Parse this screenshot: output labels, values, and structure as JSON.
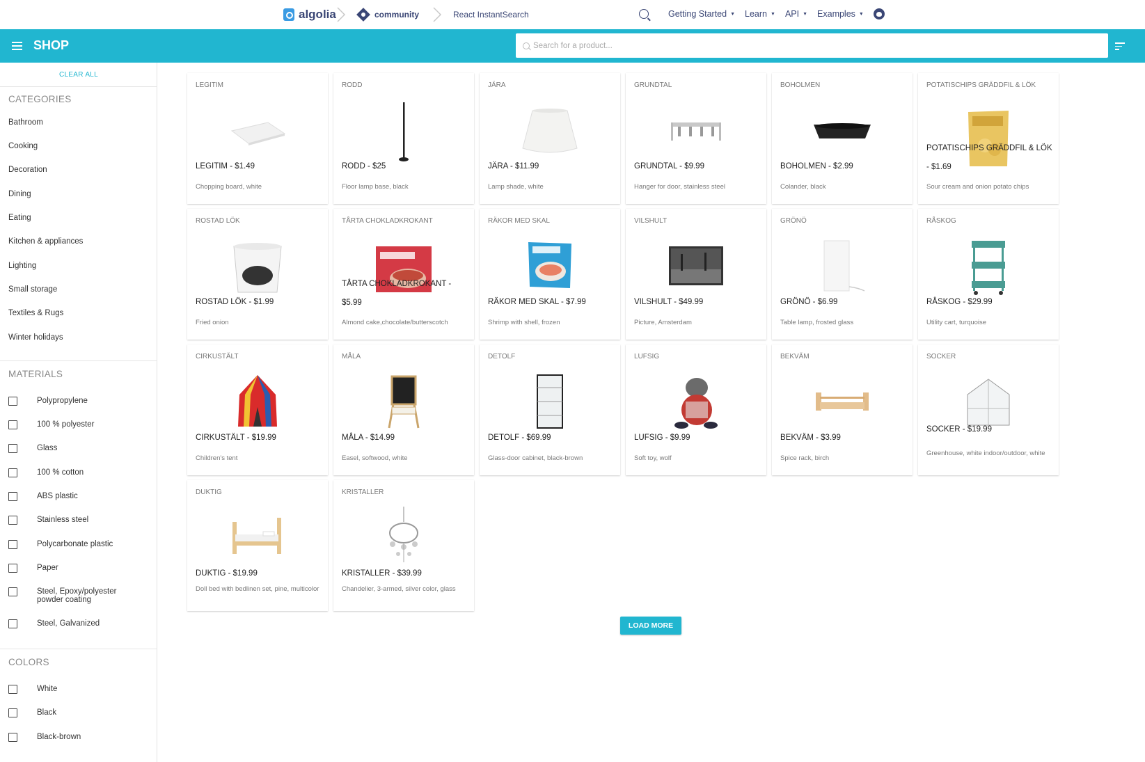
{
  "topbar": {
    "brand": "algolia",
    "community": "community",
    "section": "React InstantSearch",
    "nav": [
      {
        "label": "Getting Started",
        "dropdown": true
      },
      {
        "label": "Learn",
        "dropdown": true
      },
      {
        "label": "API",
        "dropdown": true
      },
      {
        "label": "Examples",
        "dropdown": true
      }
    ],
    "icons": [
      "search-icon",
      "github-icon"
    ]
  },
  "shop": {
    "title": "SHOP",
    "search_placeholder": "Search for a product...",
    "accent_color": "#21b6d0"
  },
  "sidebar": {
    "clear_all": "CLEAR ALL",
    "categories_title": "CATEGORIES",
    "categories": [
      "Bathroom",
      "Cooking",
      "Decoration",
      "Dining",
      "Eating",
      "Kitchen & appliances",
      "Lighting",
      "Small storage",
      "Textiles & Rugs",
      "Winter holidays"
    ],
    "materials_title": "MATERIALS",
    "materials": [
      "Polypropylene",
      "100 % polyester",
      "Glass",
      "100 % cotton",
      "ABS plastic",
      "Stainless steel",
      "Polycarbonate plastic",
      "Paper",
      "Steel, Epoxy/polyester powder coating",
      "Steel, Galvanized"
    ],
    "colors_title": "COLORS",
    "colors": [
      "White",
      "Black",
      "Black-brown"
    ]
  },
  "products": [
    {
      "category": "LEGITIM",
      "title": "LEGITIM - $1.49",
      "desc": "Chopping board, white",
      "img": "cutting-board"
    },
    {
      "category": "RODD",
      "title": "RODD - $25",
      "desc": "Floor lamp base, black",
      "img": "floor-lamp"
    },
    {
      "category": "JÄRA",
      "title": "JÄRA - $11.99",
      "desc": "Lamp shade, white",
      "img": "lamp-shade"
    },
    {
      "category": "GRUNDTAL",
      "title": "GRUNDTAL - $9.99",
      "desc": "Hanger for door, stainless steel",
      "img": "door-hanger"
    },
    {
      "category": "BOHOLMEN",
      "title": "BOHOLMEN - $2.99",
      "desc": "Colander, black",
      "img": "colander"
    },
    {
      "category": "POTATISCHIPS GRÄDDFIL & LÖK",
      "title": "POTATISCHIPS GRÄDDFIL & LÖK - $1.69",
      "desc": "Sour cream and onion potato chips",
      "img": "chips-bag"
    },
    {
      "category": "ROSTAD LÖK",
      "title": "ROSTAD LÖK - $1.99",
      "desc": "Fried onion",
      "img": "onion-tub"
    },
    {
      "category": "TÅRTA CHOKLADKROKANT",
      "title": "TÅRTA CHOKLADKROKANT - $5.99",
      "desc": "Almond cake,chocolate/butterscotch",
      "img": "cake-box"
    },
    {
      "category": "RÄKOR MED SKAL",
      "title": "RÄKOR MED SKAL - $7.99",
      "desc": "Shrimp with shell, frozen",
      "img": "shrimp-bag"
    },
    {
      "category": "VILSHULT",
      "title": "VILSHULT - $49.99",
      "desc": "Picture, Amsterdam",
      "img": "picture"
    },
    {
      "category": "GRÖNÖ",
      "title": "GRÖNÖ - $6.99",
      "desc": "Table lamp, frosted glass",
      "img": "table-lamp"
    },
    {
      "category": "RÅSKOG",
      "title": "RÅSKOG - $29.99",
      "desc": "Utility cart, turquoise",
      "img": "utility-cart"
    },
    {
      "category": "CIRKUSTÄLT",
      "title": "CIRKUSTÄLT - $19.99",
      "desc": "Children's tent",
      "img": "tent"
    },
    {
      "category": "MÅLA",
      "title": "MÅLA - $14.99",
      "desc": "Easel, softwood, white",
      "img": "easel"
    },
    {
      "category": "DETOLF",
      "title": "DETOLF - $69.99",
      "desc": "Glass-door cabinet, black-brown",
      "img": "glass-cabinet"
    },
    {
      "category": "LUFSIG",
      "title": "LUFSIG - $9.99",
      "desc": "Soft toy, wolf",
      "img": "soft-toy-wolf"
    },
    {
      "category": "BEKVÄM",
      "title": "BEKVÄM - $3.99",
      "desc": "Spice rack, birch",
      "img": "spice-rack"
    },
    {
      "category": "SOCKER",
      "title": "SOCKER - $19.99",
      "desc": "Greenhouse, white indoor/outdoor, white",
      "img": "greenhouse"
    },
    {
      "category": "DUKTIG",
      "title": "DUKTIG - $19.99",
      "desc": "Doll bed with bedlinen set, pine, multicolor",
      "img": "doll-bed"
    },
    {
      "category": "KRISTALLER",
      "title": "KRISTALLER - $39.99",
      "desc": "Chandelier, 3-armed, silver color, glass",
      "img": "chandelier"
    }
  ],
  "load_more": "LOAD MORE"
}
